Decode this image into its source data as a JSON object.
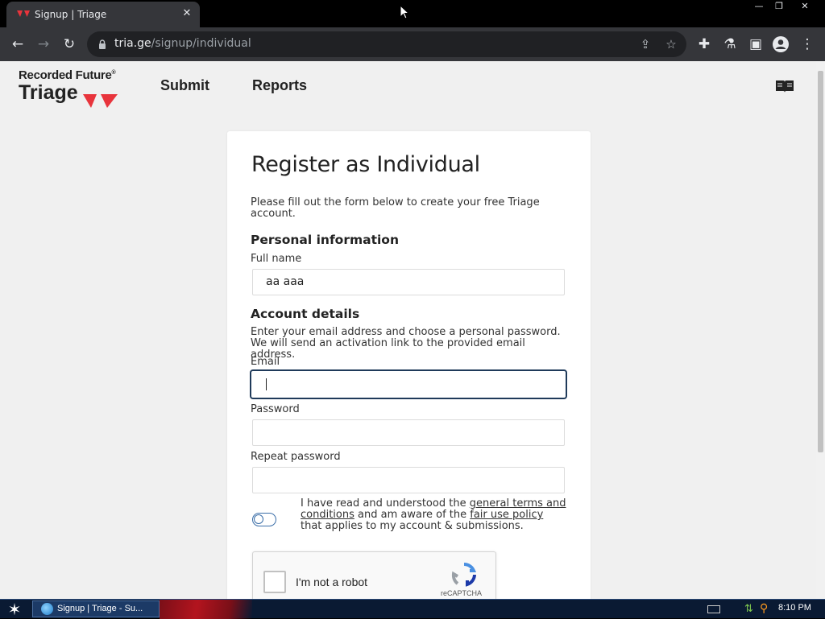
{
  "browser": {
    "tab_title": "Signup | Triage",
    "tab_close": "✕",
    "url_host": "tria.ge",
    "url_path": "/signup/individual",
    "window_controls": {
      "minimize": "—",
      "maximize": "❐",
      "close": "✕"
    }
  },
  "site": {
    "logo_top": "Recorded Future",
    "logo_trademark": "®",
    "logo_name": "Triage",
    "brand_color": "#e8343c",
    "nav": {
      "submit": "Submit",
      "reports": "Reports"
    }
  },
  "form": {
    "title": "Register as Individual",
    "intro": "Please fill out the form below to create your free Triage account.",
    "personal_heading": "Personal information",
    "full_name_label": "Full name",
    "full_name_value": "aa aaa",
    "account_heading": "Account details",
    "account_desc": "Enter your email address and choose a personal password. We will send an activation link to the provided email address.",
    "email_label": "Email",
    "email_value": "",
    "password_label": "Password",
    "password_value": "",
    "repeat_password_label": "Repeat password",
    "repeat_password_value": "",
    "terms": {
      "prefix": "I have read and understood the ",
      "link1": "general terms and conditions",
      "middle": " and am aware of the ",
      "link2": "fair use policy",
      "suffix": " that applies to my account & submissions."
    },
    "terms_accepted": false,
    "recaptcha": {
      "label": "I'm not a robot",
      "brand": "reCAPTCHA"
    }
  },
  "taskbar": {
    "task_label": "Signup | Triage - Su...",
    "clock": "8:10 PM"
  }
}
